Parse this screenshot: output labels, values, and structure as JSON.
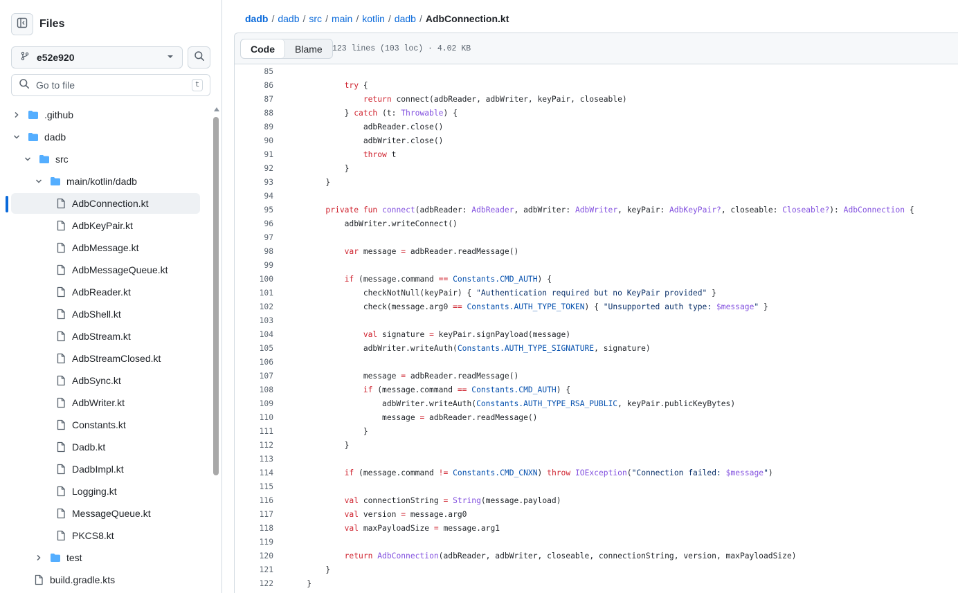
{
  "sidebar": {
    "title": "Files",
    "branch": "e52e920",
    "goto_placeholder": "Go to file",
    "goto_shortcut": "t",
    "tree": [
      {
        "name": ".github",
        "type": "folder",
        "expanded": false,
        "depth": 0
      },
      {
        "name": "dadb",
        "type": "folder",
        "expanded": true,
        "depth": 0
      },
      {
        "name": "src",
        "type": "folder",
        "expanded": true,
        "depth": 1
      },
      {
        "name": "main/kotlin/dadb",
        "type": "folder",
        "expanded": true,
        "depth": 2
      },
      {
        "name": "AdbConnection.kt",
        "type": "file",
        "depth": 3,
        "selected": true
      },
      {
        "name": "AdbKeyPair.kt",
        "type": "file",
        "depth": 3
      },
      {
        "name": "AdbMessage.kt",
        "type": "file",
        "depth": 3
      },
      {
        "name": "AdbMessageQueue.kt",
        "type": "file",
        "depth": 3
      },
      {
        "name": "AdbReader.kt",
        "type": "file",
        "depth": 3
      },
      {
        "name": "AdbShell.kt",
        "type": "file",
        "depth": 3
      },
      {
        "name": "AdbStream.kt",
        "type": "file",
        "depth": 3
      },
      {
        "name": "AdbStreamClosed.kt",
        "type": "file",
        "depth": 3
      },
      {
        "name": "AdbSync.kt",
        "type": "file",
        "depth": 3
      },
      {
        "name": "AdbWriter.kt",
        "type": "file",
        "depth": 3
      },
      {
        "name": "Constants.kt",
        "type": "file",
        "depth": 3
      },
      {
        "name": "Dadb.kt",
        "type": "file",
        "depth": 3
      },
      {
        "name": "DadbImpl.kt",
        "type": "file",
        "depth": 3
      },
      {
        "name": "Logging.kt",
        "type": "file",
        "depth": 3
      },
      {
        "name": "MessageQueue.kt",
        "type": "file",
        "depth": 3
      },
      {
        "name": "PKCS8.kt",
        "type": "file",
        "depth": 3
      },
      {
        "name": "test",
        "type": "folder",
        "expanded": false,
        "depth": 2
      },
      {
        "name": "build.gradle.kts",
        "type": "file",
        "depth": 1
      }
    ]
  },
  "breadcrumb": {
    "parts": [
      "dadb",
      "dadb",
      "src",
      "main",
      "kotlin",
      "dadb"
    ],
    "current": "AdbConnection.kt"
  },
  "toolbar": {
    "code_label": "Code",
    "blame_label": "Blame",
    "file_info": "123 lines (103 loc) · 4.02 KB"
  },
  "colors": {
    "keyword": "#cf222e",
    "type": "#8250df",
    "constant": "#0550ae",
    "string": "#0a3069",
    "link": "#0969da"
  },
  "code_lines": [
    {
      "n": "85",
      "segs": [
        [
          "",
          ""
        ]
      ]
    },
    {
      "n": "86",
      "segs": [
        [
          "",
          "            "
        ],
        [
          "k",
          "try"
        ],
        [
          "",
          " {"
        ]
      ]
    },
    {
      "n": "87",
      "segs": [
        [
          "",
          "                "
        ],
        [
          "k",
          "return"
        ],
        [
          "",
          " connect(adbReader, adbWriter, keyPair, closeable)"
        ]
      ]
    },
    {
      "n": "88",
      "segs": [
        [
          "",
          "            } "
        ],
        [
          "k",
          "catch"
        ],
        [
          "",
          " (t: "
        ],
        [
          "t",
          "Throwable"
        ],
        [
          "",
          ") {"
        ]
      ]
    },
    {
      "n": "89",
      "segs": [
        [
          "",
          "                adbReader.close()"
        ]
      ]
    },
    {
      "n": "90",
      "segs": [
        [
          "",
          "                adbWriter.close()"
        ]
      ]
    },
    {
      "n": "91",
      "segs": [
        [
          "",
          "                "
        ],
        [
          "k",
          "throw"
        ],
        [
          "",
          " t"
        ]
      ]
    },
    {
      "n": "92",
      "segs": [
        [
          "",
          "            }"
        ]
      ]
    },
    {
      "n": "93",
      "segs": [
        [
          "",
          "        }"
        ]
      ]
    },
    {
      "n": "94",
      "segs": [
        [
          "",
          ""
        ]
      ]
    },
    {
      "n": "95",
      "segs": [
        [
          "",
          "        "
        ],
        [
          "k",
          "private fun"
        ],
        [
          "",
          " "
        ],
        [
          "t",
          "connect"
        ],
        [
          "",
          "(adbReader: "
        ],
        [
          "t",
          "AdbReader"
        ],
        [
          "",
          ", adbWriter: "
        ],
        [
          "t",
          "AdbWriter"
        ],
        [
          "",
          ", keyPair: "
        ],
        [
          "t",
          "AdbKeyPair?"
        ],
        [
          "",
          ", closeable: "
        ],
        [
          "t",
          "Closeable?"
        ],
        [
          "",
          "): "
        ],
        [
          "t",
          "AdbConnection"
        ],
        [
          "",
          " {"
        ]
      ]
    },
    {
      "n": "96",
      "segs": [
        [
          "",
          "            adbWriter.writeConnect()"
        ]
      ]
    },
    {
      "n": "97",
      "segs": [
        [
          "",
          ""
        ]
      ]
    },
    {
      "n": "98",
      "segs": [
        [
          "",
          "            "
        ],
        [
          "k",
          "var"
        ],
        [
          "",
          " message "
        ],
        [
          "k",
          "="
        ],
        [
          "",
          " adbReader.readMessage()"
        ]
      ]
    },
    {
      "n": "99",
      "segs": [
        [
          "",
          ""
        ]
      ]
    },
    {
      "n": "100",
      "segs": [
        [
          "",
          "            "
        ],
        [
          "k",
          "if"
        ],
        [
          "",
          " (message.command "
        ],
        [
          "k",
          "=="
        ],
        [
          "",
          " "
        ],
        [
          "c",
          "Constants.CMD_AUTH"
        ],
        [
          "",
          ") {"
        ]
      ]
    },
    {
      "n": "101",
      "segs": [
        [
          "",
          "                checkNotNull(keyPair) { "
        ],
        [
          "s",
          "\"Authentication required but no KeyPair provided\""
        ],
        [
          "",
          " }"
        ]
      ]
    },
    {
      "n": "102",
      "segs": [
        [
          "",
          "                check(message.arg0 "
        ],
        [
          "k",
          "=="
        ],
        [
          "",
          " "
        ],
        [
          "c",
          "Constants.AUTH_TYPE_TOKEN"
        ],
        [
          "",
          ") { "
        ],
        [
          "s",
          "\"Unsupported auth type: "
        ],
        [
          "t",
          "$message"
        ],
        [
          "s",
          "\""
        ],
        [
          "",
          " }"
        ]
      ]
    },
    {
      "n": "103",
      "segs": [
        [
          "",
          ""
        ]
      ]
    },
    {
      "n": "104",
      "segs": [
        [
          "",
          "                "
        ],
        [
          "k",
          "val"
        ],
        [
          "",
          " signature "
        ],
        [
          "k",
          "="
        ],
        [
          "",
          " keyPair.signPayload(message)"
        ]
      ]
    },
    {
      "n": "105",
      "segs": [
        [
          "",
          "                adbWriter.writeAuth("
        ],
        [
          "c",
          "Constants.AUTH_TYPE_SIGNATURE"
        ],
        [
          "",
          ", signature)"
        ]
      ]
    },
    {
      "n": "106",
      "segs": [
        [
          "",
          ""
        ]
      ]
    },
    {
      "n": "107",
      "segs": [
        [
          "",
          "                message "
        ],
        [
          "k",
          "="
        ],
        [
          "",
          " adbReader.readMessage()"
        ]
      ]
    },
    {
      "n": "108",
      "segs": [
        [
          "",
          "                "
        ],
        [
          "k",
          "if"
        ],
        [
          "",
          " (message.command "
        ],
        [
          "k",
          "=="
        ],
        [
          "",
          " "
        ],
        [
          "c",
          "Constants.CMD_AUTH"
        ],
        [
          "",
          ") {"
        ]
      ]
    },
    {
      "n": "109",
      "segs": [
        [
          "",
          "                    adbWriter.writeAuth("
        ],
        [
          "c",
          "Constants.AUTH_TYPE_RSA_PUBLIC"
        ],
        [
          "",
          ", keyPair.publicKeyBytes)"
        ]
      ]
    },
    {
      "n": "110",
      "segs": [
        [
          "",
          "                    message "
        ],
        [
          "k",
          "="
        ],
        [
          "",
          " adbReader.readMessage()"
        ]
      ]
    },
    {
      "n": "111",
      "segs": [
        [
          "",
          "                }"
        ]
      ]
    },
    {
      "n": "112",
      "segs": [
        [
          "",
          "            }"
        ]
      ]
    },
    {
      "n": "113",
      "segs": [
        [
          "",
          ""
        ]
      ]
    },
    {
      "n": "114",
      "segs": [
        [
          "",
          "            "
        ],
        [
          "k",
          "if"
        ],
        [
          "",
          " (message.command "
        ],
        [
          "k",
          "!="
        ],
        [
          "",
          " "
        ],
        [
          "c",
          "Constants.CMD_CNXN"
        ],
        [
          "",
          ") "
        ],
        [
          "k",
          "throw"
        ],
        [
          "",
          " "
        ],
        [
          "t",
          "IOException"
        ],
        [
          "",
          "("
        ],
        [
          "s",
          "\"Connection failed: "
        ],
        [
          "t",
          "$message"
        ],
        [
          "s",
          "\""
        ],
        [
          "",
          ")"
        ]
      ]
    },
    {
      "n": "115",
      "segs": [
        [
          "",
          ""
        ]
      ]
    },
    {
      "n": "116",
      "segs": [
        [
          "",
          "            "
        ],
        [
          "k",
          "val"
        ],
        [
          "",
          " connectionString "
        ],
        [
          "k",
          "="
        ],
        [
          "",
          " "
        ],
        [
          "t",
          "String"
        ],
        [
          "",
          "(message.payload)"
        ]
      ]
    },
    {
      "n": "117",
      "segs": [
        [
          "",
          "            "
        ],
        [
          "k",
          "val"
        ],
        [
          "",
          " version "
        ],
        [
          "k",
          "="
        ],
        [
          "",
          " message.arg0"
        ]
      ]
    },
    {
      "n": "118",
      "segs": [
        [
          "",
          "            "
        ],
        [
          "k",
          "val"
        ],
        [
          "",
          " maxPayloadSize "
        ],
        [
          "k",
          "="
        ],
        [
          "",
          " message.arg1"
        ]
      ]
    },
    {
      "n": "119",
      "segs": [
        [
          "",
          ""
        ]
      ]
    },
    {
      "n": "120",
      "segs": [
        [
          "",
          "            "
        ],
        [
          "k",
          "return"
        ],
        [
          "",
          " "
        ],
        [
          "t",
          "AdbConnection"
        ],
        [
          "",
          "(adbReader, adbWriter, closeable, connectionString, version, maxPayloadSize)"
        ]
      ]
    },
    {
      "n": "121",
      "segs": [
        [
          "",
          "        }"
        ]
      ]
    },
    {
      "n": "122",
      "segs": [
        [
          "",
          "    }"
        ]
      ]
    }
  ]
}
